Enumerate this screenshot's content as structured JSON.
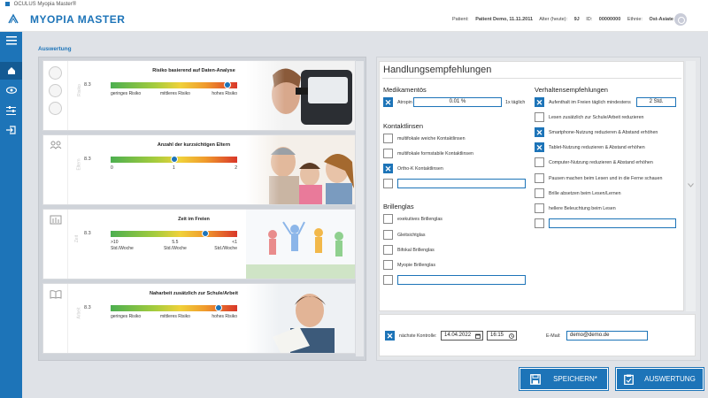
{
  "titlebar": {
    "text": "OCULUS Myopia Master®"
  },
  "header": {
    "brand": "MYOPIA MASTER",
    "patient_label": "Patient:",
    "patient_value": "Patient Demo, 11.11.2011",
    "age_label": "Alter (heute):",
    "age_value": "9J",
    "id_label": "ID:",
    "id_value": "00000000",
    "ethnic_label": "Ethnie:",
    "ethnic_value": "Ost-Asiate"
  },
  "sidebar": {
    "items": [
      "home-icon",
      "eye-icon",
      "sliders-icon",
      "logout-icon"
    ]
  },
  "section": {
    "label": "Auswertung"
  },
  "rows": [
    {
      "title": "Risiko basierend auf Daten-Analyse",
      "value": "8.3",
      "side_label": "Risiko",
      "scale": [
        "geringes Risiko",
        "mittleres Risiko",
        "hohes Risiko"
      ],
      "knob_fraction": 0.92
    },
    {
      "title": "Anzahl der kurzsichtigen Eltern",
      "value": "8.3",
      "side_label": "Eltern",
      "scale": [
        "0",
        "1",
        "2"
      ],
      "knob_fraction": 0.5
    },
    {
      "title": "Zeit im Freien",
      "value": "8.3",
      "side_label": "Zeit",
      "scale": [
        ">10\nStd./Woche",
        "5.5\nStd./Woche",
        "<1\nStd./Woche"
      ],
      "knob_fraction": 0.75
    },
    {
      "title": "Naharbeit zusätzlich zur Schule/Arbeit",
      "value": "8.3",
      "side_label": "Arbeit",
      "scale": [
        "geringes Risiko",
        "mittleres Risiko",
        "hohes Risiko"
      ],
      "knob_fraction": 0.85
    }
  ],
  "recommendations": {
    "title": "Handlungsempfehlungen",
    "medikamente": {
      "title": "Medikamentös",
      "atropin_label": "Atropin",
      "atropin_value": "0.01 %",
      "atropin_suffix": "1x täglich",
      "atropin_checked": true
    },
    "kontaktlinsen": {
      "title": "Kontaktlinsen",
      "items": [
        {
          "label": "multifokale weiche Kontaktlinsen",
          "checked": false
        },
        {
          "label": "multifokale formstabile Kontaktlinsen",
          "checked": false
        },
        {
          "label": "Ortho-K Kontaktlinsen",
          "checked": true
        }
      ]
    },
    "brillenglas": {
      "title": "Brillenglas",
      "items": [
        {
          "label": "exekutives Brillenglas",
          "checked": false
        },
        {
          "label": "Gleitsichtglas",
          "checked": false
        },
        {
          "label": "Bifokal Brillenglas",
          "checked": false
        },
        {
          "label": "Myopie Brillenglas",
          "checked": false
        }
      ]
    },
    "verhalten": {
      "title": "Verhaltensempfehlungen",
      "items": [
        {
          "label": "Aufenthalt im Freien täglich mindestens",
          "checked": true,
          "field": "2 Std."
        },
        {
          "label": "Lesen zusätzlich zur Schule/Arbeit reduzieren",
          "checked": false
        },
        {
          "label": "Smartphone-Nutzung reduzieren & Abstand erhöhen",
          "checked": true
        },
        {
          "label": "Tablet-Nutzung reduzieren & Abstand erhöhen",
          "checked": true
        },
        {
          "label": "Computer-Nutzung reduzieren & Abstand erhöhen",
          "checked": false
        },
        {
          "label": "Pausen machen beim Lesen und in die Ferne schauen",
          "checked": false
        },
        {
          "label": "Brille absetzen beim Lesen/Lernen",
          "checked": false
        },
        {
          "label": "hellere Beleuchtung beim Lesen",
          "checked": false
        }
      ]
    }
  },
  "control": {
    "label": "nächste Kontrolle:",
    "checked": true,
    "date": "14.04.2022",
    "time": "16:15",
    "email_label": "E-Mail:",
    "email_value": "demo@demo.de"
  },
  "buttons": {
    "save": "SPEICHERN*",
    "report": "AUSWERTUNG"
  },
  "colors": {
    "accent": "#1d74b8",
    "sidebar": "#1d74b8"
  }
}
